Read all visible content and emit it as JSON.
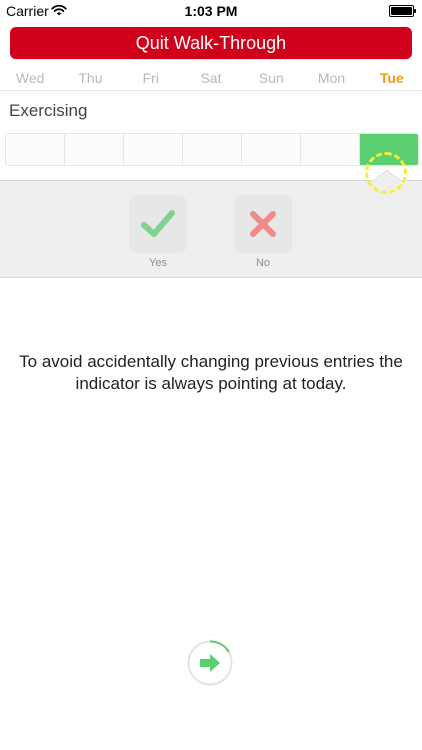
{
  "status_bar": {
    "carrier": "Carrier",
    "time": "1:03 PM"
  },
  "walkthrough": {
    "quit_label": "Quit Walk-Through"
  },
  "days": [
    {
      "label": "Wed",
      "active": false
    },
    {
      "label": "Thu",
      "active": false
    },
    {
      "label": "Fri",
      "active": false
    },
    {
      "label": "Sat",
      "active": false
    },
    {
      "label": "Sun",
      "active": false
    },
    {
      "label": "Mon",
      "active": false
    },
    {
      "label": "Tue",
      "active": true
    }
  ],
  "habit": {
    "title": "Exercising",
    "cells_done": [
      false,
      false,
      false,
      false,
      false,
      false,
      true
    ]
  },
  "answers": {
    "yes_label": "Yes",
    "no_label": "No"
  },
  "instruction": "To avoid accidentally changing previous entries the indicator is always pointing at today.",
  "colors": {
    "quit": "#d0021b",
    "accent_day": "#f09a1a",
    "done": "#5bcf72",
    "yes_icon": "#7fd38e",
    "no_icon": "#ee8a8a",
    "highlight": "#f2f03a"
  },
  "icons": {
    "wifi": "wifi-icon",
    "battery": "battery-icon",
    "yes": "checkmark-icon",
    "no": "cross-icon",
    "next": "arrow-right-icon"
  }
}
